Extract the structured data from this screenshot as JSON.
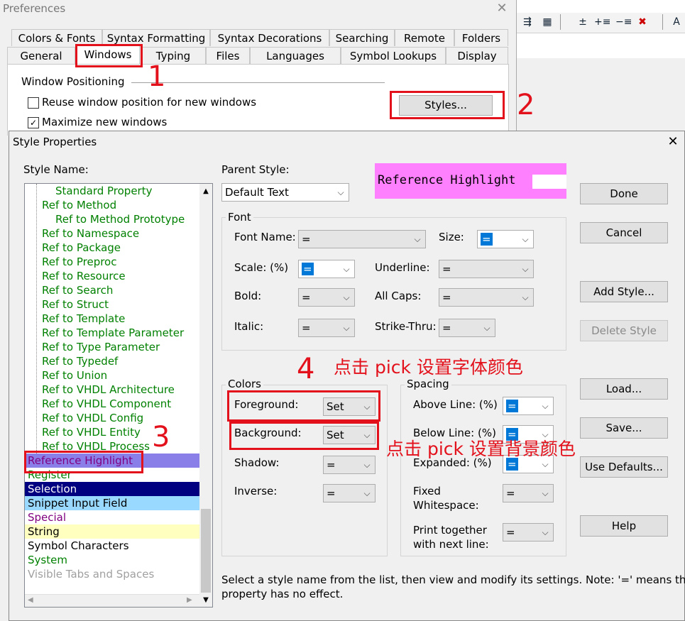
{
  "preferences": {
    "title": "Preferences",
    "tabs_row1": [
      "Colors & Fonts",
      "Syntax Formatting",
      "Syntax Decorations",
      "Searching",
      "Remote",
      "Folders"
    ],
    "tabs_row2": [
      "General",
      "Windows",
      "Typing",
      "Files",
      "Languages",
      "Symbol Lookups",
      "Display"
    ],
    "active_tab": "Windows",
    "section_title": "Window Positioning",
    "reuse_label": "Reuse window position for new windows",
    "reuse_checked": false,
    "maximize_label": "Maximize new windows",
    "maximize_checked": true,
    "styles_button": "Styles..."
  },
  "annotations": {
    "n1": "1",
    "n2": "2",
    "n3": "3",
    "n4": "4",
    "text4": "点击 pick 设置字体颜色",
    "text5": "点击 pick 设置背景颜色",
    "color": "#e3111b"
  },
  "dialog": {
    "title": "Style Properties",
    "style_name_label": "Style Name:",
    "style_items": [
      {
        "text": "Standard Property",
        "color": "#008000",
        "indent": 2
      },
      {
        "text": "Ref to Method",
        "color": "#008000",
        "indent": 1
      },
      {
        "text": "Ref to Method Prototype",
        "color": "#008000",
        "indent": 2
      },
      {
        "text": "Ref to Namespace",
        "color": "#008000",
        "indent": 1
      },
      {
        "text": "Ref to Package",
        "color": "#008000",
        "indent": 1
      },
      {
        "text": "Ref to Preproc",
        "color": "#008000",
        "indent": 1
      },
      {
        "text": "Ref to Resource",
        "color": "#008000",
        "indent": 1
      },
      {
        "text": "Ref to Search",
        "color": "#008000",
        "indent": 1
      },
      {
        "text": "Ref to Struct",
        "color": "#008000",
        "indent": 1
      },
      {
        "text": "Ref to Template",
        "color": "#008000",
        "indent": 1
      },
      {
        "text": "Ref to Template Parameter",
        "color": "#008000",
        "indent": 1
      },
      {
        "text": "Ref to Type Parameter",
        "color": "#008000",
        "indent": 1
      },
      {
        "text": "Ref to Typedef",
        "color": "#008000",
        "indent": 1
      },
      {
        "text": "Ref to Union",
        "color": "#008000",
        "indent": 1
      },
      {
        "text": "Ref to VHDL Architecture",
        "color": "#008000",
        "indent": 1
      },
      {
        "text": "Ref to VHDL Component",
        "color": "#008000",
        "indent": 1
      },
      {
        "text": "Ref to VHDL Config",
        "color": "#008000",
        "indent": 1
      },
      {
        "text": "Ref to VHDL Entity",
        "color": "#008000",
        "indent": 1
      },
      {
        "text": "Ref to VHDL Process",
        "color": "#008000",
        "indent": 1
      },
      {
        "text": "Reference Highlight",
        "color": "#800080",
        "bg": "#8a7fe8",
        "indent": 0,
        "selected": true
      },
      {
        "text": "Register",
        "color": "#008000",
        "indent": 0
      },
      {
        "text": "Selection",
        "color": "#ffffff",
        "bg": "#000080",
        "indent": 0
      },
      {
        "text": "Snippet Input Field",
        "color": "#000000",
        "bg": "#99d9ff",
        "indent": 0
      },
      {
        "text": "Special",
        "color": "#800080",
        "indent": 0
      },
      {
        "text": "String",
        "color": "#000000",
        "bg": "#ffffc0",
        "indent": 0
      },
      {
        "text": "Symbol Characters",
        "color": "#000000",
        "indent": 0
      },
      {
        "text": "System",
        "color": "#008000",
        "indent": 0
      },
      {
        "text": "Visible Tabs and Spaces",
        "color": "#a0a0a0",
        "indent": 0
      }
    ],
    "parent_style_label": "Parent Style:",
    "parent_style_value": "Default Text",
    "preview_text": "Reference Highlight",
    "preview_bg": "#ff80ff",
    "font_group": "Font",
    "font_name_label": "Font Name:",
    "font_name_value": "=",
    "size_label": "Size:",
    "size_value": "=",
    "scale_label": "Scale: (%)",
    "scale_value": "=",
    "underline_label": "Underline:",
    "underline_value": "=",
    "bold_label": "Bold:",
    "bold_value": "=",
    "allcaps_label": "All Caps:",
    "allcaps_value": "=",
    "italic_label": "Italic:",
    "italic_value": "=",
    "strike_label": "Strike-Thru:",
    "strike_value": "=",
    "colors_group": "Colors",
    "foreground_label": "Foreground:",
    "foreground_value": "Set",
    "background_label": "Background:",
    "background_value": "Set",
    "shadow_label": "Shadow:",
    "shadow_value": "=",
    "inverse_label": "Inverse:",
    "inverse_value": "=",
    "spacing_group": "Spacing",
    "above_label": "Above Line: (%)",
    "above_value": "=",
    "below_label": "Below Line: (%)",
    "below_value": "=",
    "expanded_label": "Expanded: (%)",
    "expanded_value": "=",
    "fixed_label_1": "Fixed",
    "fixed_label_2": "Whitespace:",
    "fixed_value": "=",
    "print_label_1": "Print together",
    "print_label_2": "with next line:",
    "print_value": "=",
    "buttons": {
      "done": "Done",
      "cancel": "Cancel",
      "add_style": "Add Style...",
      "delete_style": "Delete Style",
      "load": "Load...",
      "save": "Save...",
      "use_defaults": "Use Defaults...",
      "help": "Help"
    },
    "note_line1": "Select a style name from the list, then view and modify its settings. Note: '=' means the",
    "note_line2": "property has no effect."
  }
}
